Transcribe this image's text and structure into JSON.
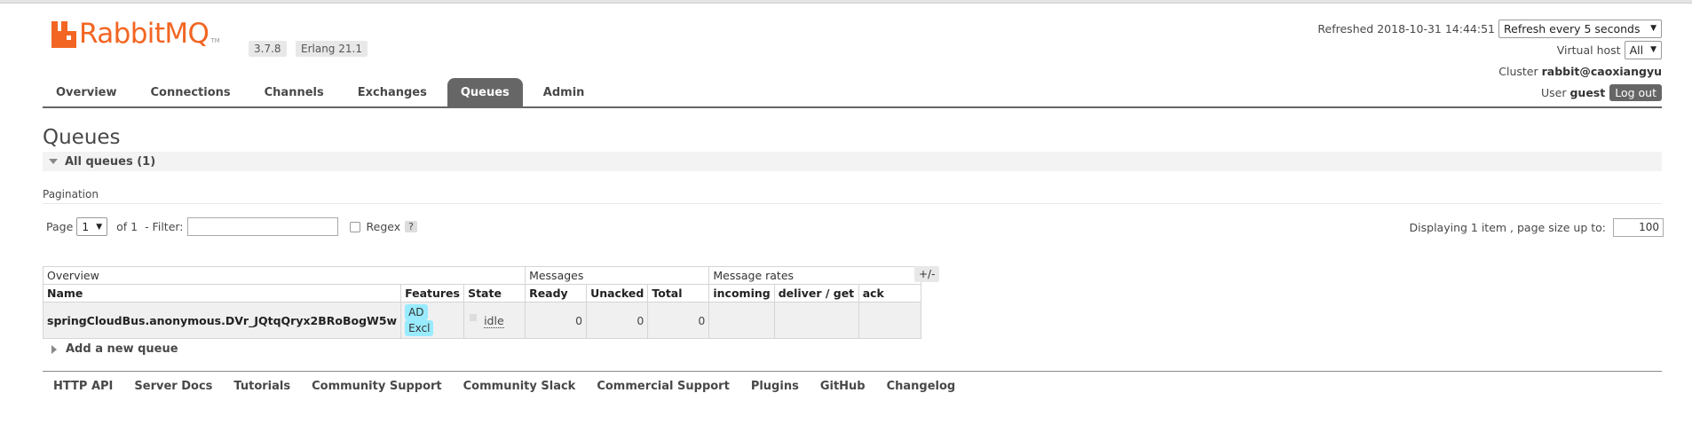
{
  "app": {
    "name": "RabbitMQ",
    "tm": "TM",
    "rabbit_version": "3.7.8",
    "erlang_version": "Erlang 21.1"
  },
  "status": {
    "refreshed_label": "Refreshed",
    "refreshed_time": "2018-10-31 14:44:51",
    "refresh_select": "Refresh every 5 seconds",
    "vhost_label": "Virtual host",
    "vhost_value": "All",
    "cluster_label": "Cluster",
    "cluster_value": "rabbit@caoxiangyu",
    "user_label": "User",
    "user_value": "guest",
    "logout": "Log out"
  },
  "nav": {
    "tabs": [
      "Overview",
      "Connections",
      "Channels",
      "Exchanges",
      "Queues",
      "Admin"
    ],
    "active": "Queues"
  },
  "page": {
    "title": "Queues",
    "section": "All queues (1)"
  },
  "pagination": {
    "heading": "Pagination",
    "page_label": "Page",
    "page_value": "1",
    "of_label": "of 1",
    "filter_label": "- Filter:",
    "regex_label": "Regex",
    "help": "?",
    "display_label": "Displaying 1 item , page size up to:",
    "page_size": "100"
  },
  "table": {
    "groups": {
      "overview": "Overview",
      "messages": "Messages",
      "rates": "Message rates"
    },
    "plus_minus": "+/-",
    "headers": {
      "name": "Name",
      "features": "Features",
      "state": "State",
      "ready": "Ready",
      "unacked": "Unacked",
      "total": "Total",
      "incoming": "incoming",
      "deliver": "deliver / get",
      "ack": "ack"
    },
    "rows": [
      {
        "name": "springCloudBus.anonymous.DVr_JQtqQryx2BRoBogW5w",
        "features": [
          "AD",
          "Excl"
        ],
        "state": "idle",
        "ready": "0",
        "unacked": "0",
        "total": "0"
      }
    ]
  },
  "add_queue": "Add a new queue",
  "footer": [
    "HTTP API",
    "Server Docs",
    "Tutorials",
    "Community Support",
    "Community Slack",
    "Commercial Support",
    "Plugins",
    "GitHub",
    "Changelog"
  ],
  "colors": {
    "accent": "#f26522",
    "tab_active": "#666666",
    "tag": "#99ebff"
  }
}
